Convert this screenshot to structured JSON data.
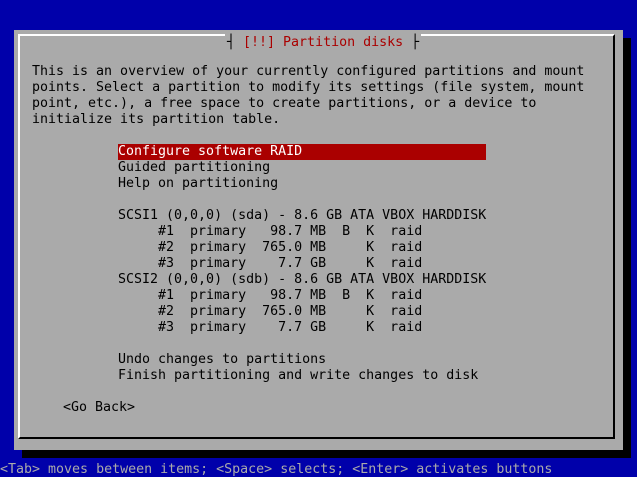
{
  "title": "[!!] Partition disks",
  "description": [
    "This is an overview of your currently configured partitions and mount",
    "points. Select a partition to modify its settings (file system, mount",
    "point, etc.), a free space to create partitions, or a device to",
    "initialize its partition table."
  ],
  "menu": [
    {
      "text": "Configure software RAID",
      "selected": true
    },
    {
      "text": "Guided partitioning"
    },
    {
      "text": "Help on partitioning"
    },
    {
      "text": ""
    },
    {
      "text": "SCSI1 (0,0,0) (sda) - 8.6 GB ATA VBOX HARDDISK"
    },
    {
      "text": "     #1  primary   98.7 MB  B  K  raid"
    },
    {
      "text": "     #2  primary  765.0 MB     K  raid"
    },
    {
      "text": "     #3  primary    7.7 GB     K  raid"
    },
    {
      "text": "SCSI2 (0,0,0) (sdb) - 8.6 GB ATA VBOX HARDDISK"
    },
    {
      "text": "     #1  primary   98.7 MB  B  K  raid"
    },
    {
      "text": "     #2  primary  765.0 MB     K  raid"
    },
    {
      "text": "     #3  primary    7.7 GB     K  raid"
    },
    {
      "text": ""
    },
    {
      "text": "Undo changes to partitions"
    },
    {
      "text": "Finish partitioning and write changes to disk"
    }
  ],
  "go_back": "<Go Back>",
  "status": "<Tab> moves between items; <Space> selects; <Enter> activates buttons",
  "colors": {
    "background": "#0000aa",
    "dialog": "#aaaaaa",
    "title": "#aa0000",
    "selection_bg": "#aa0000",
    "selection_fg": "#ffffff"
  }
}
